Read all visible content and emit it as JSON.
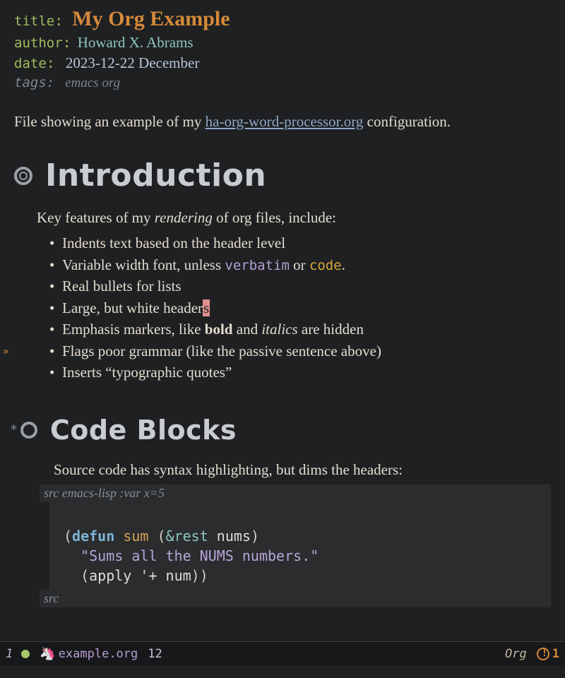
{
  "meta": {
    "title_key": "title",
    "title_value": "My Org Example",
    "author_key": "author",
    "author_value": "Howard X. Abrams",
    "date_key": "date",
    "date_value": "2023-12-22 December",
    "tags_key": "tags:",
    "tags_value": "emacs org"
  },
  "intro_prose_pre": "File showing an example of my ",
  "intro_link": "ha-org-word-processor.org",
  "intro_prose_post": " configuration.",
  "section1": {
    "title": "Introduction",
    "lead_pre": "Key features of my ",
    "lead_em": "rendering",
    "lead_post": " of org files, include:",
    "bullets": {
      "b1": "Indents text based on the header level",
      "b2_pre": "Variable width font, unless ",
      "b2_verbatim": "verbatim",
      "b2_mid": " or ",
      "b2_code": "code",
      "b2_post": ".",
      "b3": "Real bullets for lists",
      "b4_pre": "Large, but white header",
      "b4_cursor": "s",
      "b5_pre": "Emphasis markers, like ",
      "b5_bold": "bold",
      "b5_mid": " and ",
      "b5_italic": "italics",
      "b5_post": " are hidden",
      "b6": "Flags poor grammar (like the passive sentence above)",
      "b7": "Inserts “typographic quotes”"
    }
  },
  "section2": {
    "star": "*",
    "title": "Code Blocks",
    "lead": "Source code has syntax highlighting, but dims the headers:",
    "src_header_label": "src",
    "src_header_args": "emacs-lisp :var x=5",
    "code": {
      "l1_paren1": "(",
      "l1_defun": "defun",
      "l1_sp1": " ",
      "l1_fn": "sum",
      "l1_sp2": " ",
      "l1_paren2": "(",
      "l1_amp": "&rest",
      "l1_sp3": " ",
      "l1_arg": "nums",
      "l1_paren3": ")",
      "l2_indent": "  ",
      "l2_str": "\"Sums all the NUMS numbers.\"",
      "l3_indent": "  ",
      "l3_paren1": "(",
      "l3_apply": "apply",
      "l3_rest": " '+ num",
      "l3_paren2": "))"
    },
    "src_footer_label": "src"
  },
  "modeline": {
    "window_num": "1",
    "filename": "example.org",
    "line": "12",
    "major_mode": "Org",
    "flycheck_count": "1"
  }
}
